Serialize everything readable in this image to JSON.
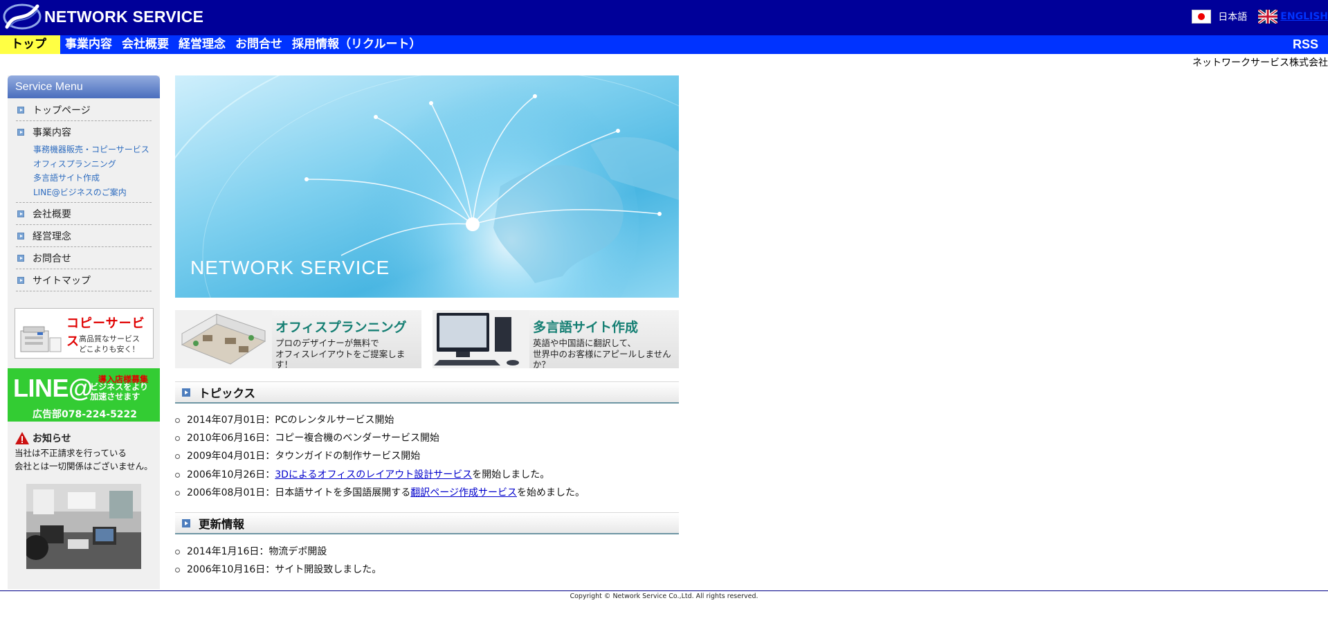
{
  "header": {
    "logo_text": "NETWORK SERVICE",
    "lang_jp": "日本語",
    "lang_en": "ENGLISH"
  },
  "nav": {
    "items": [
      "トップ",
      "事業内容",
      "会社概要",
      "経営理念",
      "お問合せ",
      "採用情報（リクルート）"
    ],
    "active": "トップ",
    "rss": "RSS"
  },
  "company_name": "ネットワークサービス株式会社",
  "sidebar": {
    "menu_title": "Service Menu",
    "items": [
      {
        "label": "トップページ"
      },
      {
        "label": "事業内容",
        "subs": [
          "事務機器販売・コピーサービス",
          "オフィスプランニング",
          "多言語サイト作成",
          "LINE@ビジネスのご案内"
        ]
      },
      {
        "label": "会社概要"
      },
      {
        "label": "経営理念"
      },
      {
        "label": "お問合せ"
      },
      {
        "label": "サイトマップ"
      }
    ],
    "copy_banner": {
      "title": "コピーサービス",
      "line1": "高品質なサービス",
      "line2": "どこよりも安く！"
    },
    "line_banner": {
      "logo": "LINE@",
      "recruit": "導入店様募集",
      "line1": "ビジネスをより",
      "line2": "加速させます",
      "phone": "広告部078-224-5222"
    },
    "notice": {
      "title": "お知らせ",
      "line1": "当社は不正請求を行っている",
      "line2": "会社とは一切関係はございません。"
    }
  },
  "hero": {
    "text": "NETWORK SERVICE"
  },
  "banners": [
    {
      "title": "オフィスプランニング",
      "line1": "プロのデザイナーが無料で",
      "line2": "オフィスレイアウトをご提案します！"
    },
    {
      "title": "多言語サイト作成",
      "line1": "英語や中国語に翻訳して、",
      "line2": "世界中のお客様にアピールしませんか？"
    }
  ],
  "topics": {
    "title": "トピックス",
    "items": [
      {
        "pre": "2014年07月01日：PCのレンタルサービス開始",
        "link": "",
        "post": ""
      },
      {
        "pre": "2010年06月16日：コピー複合機のベンダーサービス開始",
        "link": "",
        "post": ""
      },
      {
        "pre": "2009年04月01日：タウンガイドの制作サービス開始",
        "link": "",
        "post": ""
      },
      {
        "pre": "2006年10月26日：",
        "link": "3Dによるオフィスのレイアウト設計サービス",
        "post": "を開始しました。"
      },
      {
        "pre": "2006年08月01日：日本語サイトを多国語展開する",
        "link": "翻訳ページ作成サービス",
        "post": "を始めました。"
      }
    ]
  },
  "updates": {
    "title": "更新情報",
    "items": [
      "2014年1月16日：物流デポ開設",
      "2006年10月16日：サイト開設致しました。"
    ]
  },
  "footer": {
    "copyright": "Copyright © Network Service Co.,Ltd. All rights reserved."
  }
}
